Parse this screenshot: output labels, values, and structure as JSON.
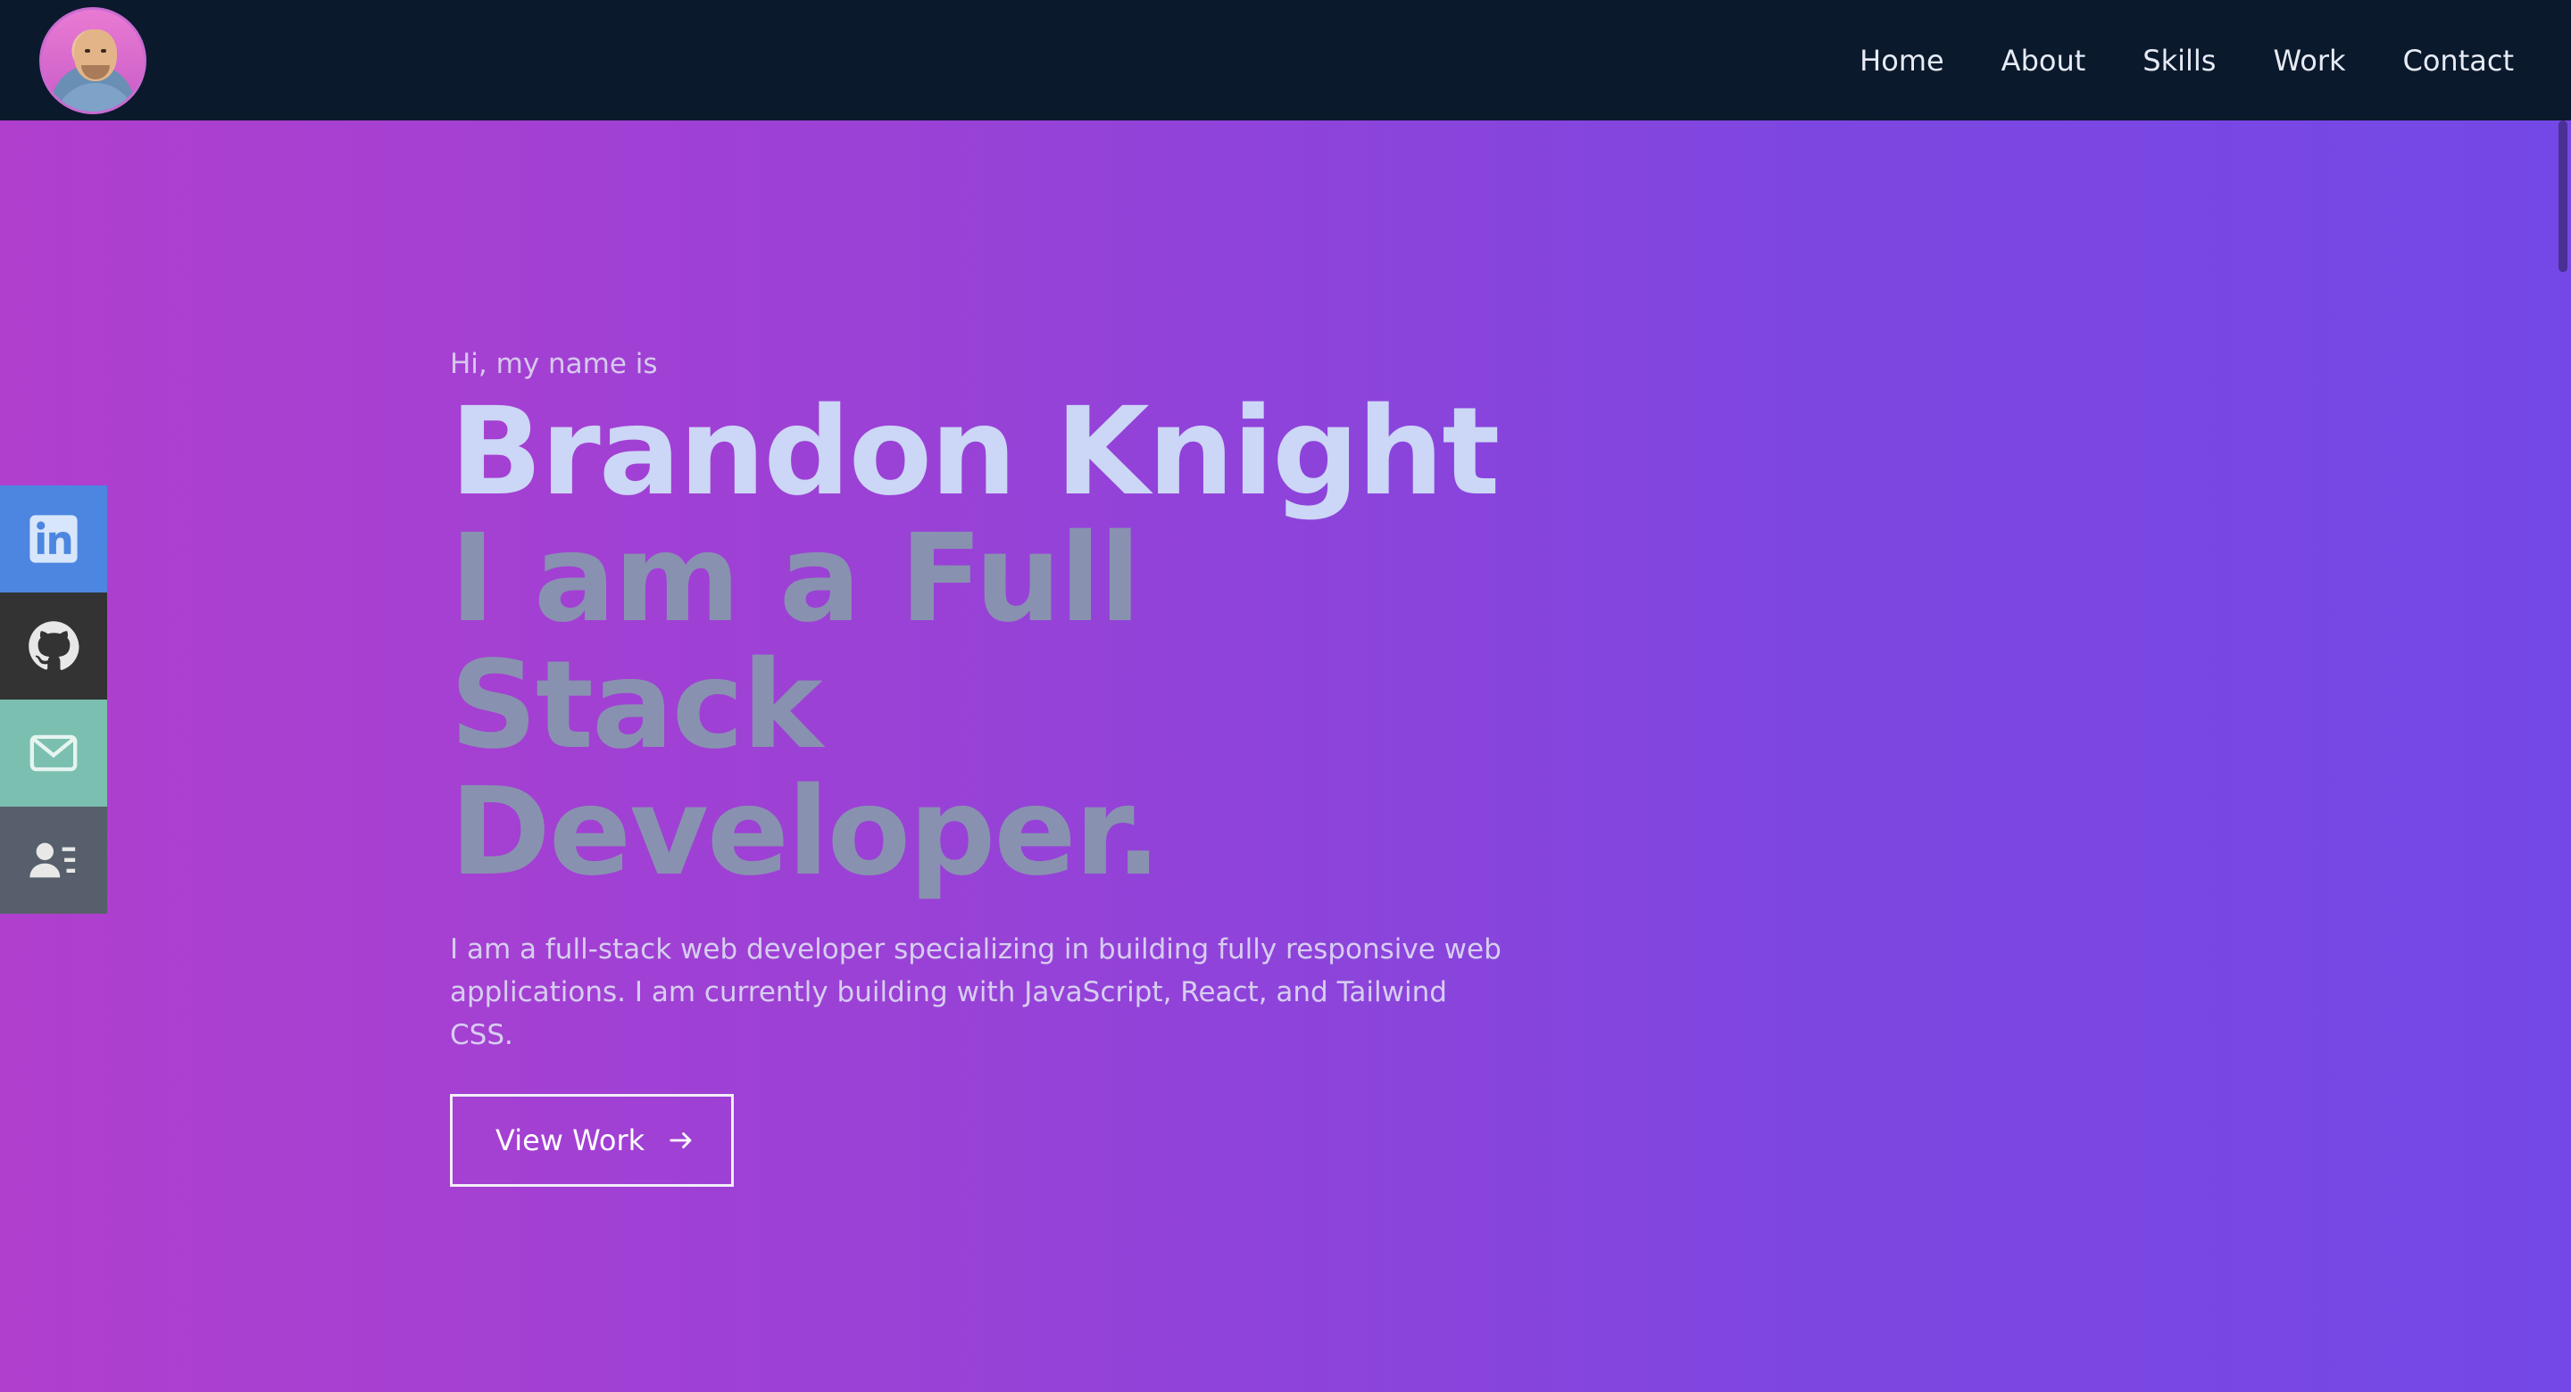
{
  "navbar": {
    "links": [
      "Home",
      "About",
      "Skills",
      "Work",
      "Contact"
    ]
  },
  "social": [
    {
      "name": "linkedin-icon",
      "color": "#4c86e0"
    },
    {
      "name": "github-icon",
      "color": "#333333"
    },
    {
      "name": "mail-icon",
      "color": "#7bbfb0"
    },
    {
      "name": "resume-icon",
      "color": "#565f6b"
    }
  ],
  "hero": {
    "greeting": "Hi, my name is",
    "name": "Brandon Knight",
    "role_line1": "I am a Full Stack",
    "role_line2": "Developer.",
    "intro_line1": "I am a full-stack web developer specializing in building fully responsive web",
    "intro_line2": "applications. I am currently building with JavaScript, React, and Tailwind CSS.",
    "button_label": "View Work"
  },
  "colors": {
    "navbar_bg": "#0b192c",
    "name_color": "#ccd6f6",
    "role_color": "#8892b0"
  }
}
